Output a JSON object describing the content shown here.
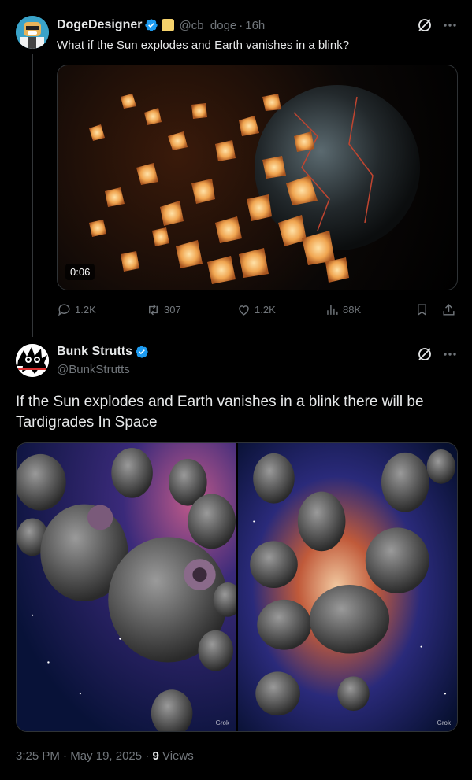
{
  "post1": {
    "display_name": "DogeDesigner",
    "handle": "@cb_doge",
    "time": "16h",
    "text": "What if the Sun explodes and Earth vanishes in a blink?",
    "video_duration": "0:06",
    "actions": {
      "replies": "1.2K",
      "reposts": "307",
      "likes": "1.2K",
      "views": "88K"
    }
  },
  "post2": {
    "display_name": "Bunk Strutts",
    "handle": "@BunkStrutts",
    "text": "If the Sun explodes and Earth vanishes in a blink there will be Tardigrades In Space",
    "image_watermark": "Grok",
    "time": "3:25 PM",
    "date": "May 19, 2025",
    "views_count": "9",
    "views_label": "Views"
  },
  "colors": {
    "background": "#000000",
    "text_primary": "#e7e9ea",
    "text_secondary": "#71767b",
    "verified": "#1d9bf0",
    "border": "#2f3336"
  }
}
